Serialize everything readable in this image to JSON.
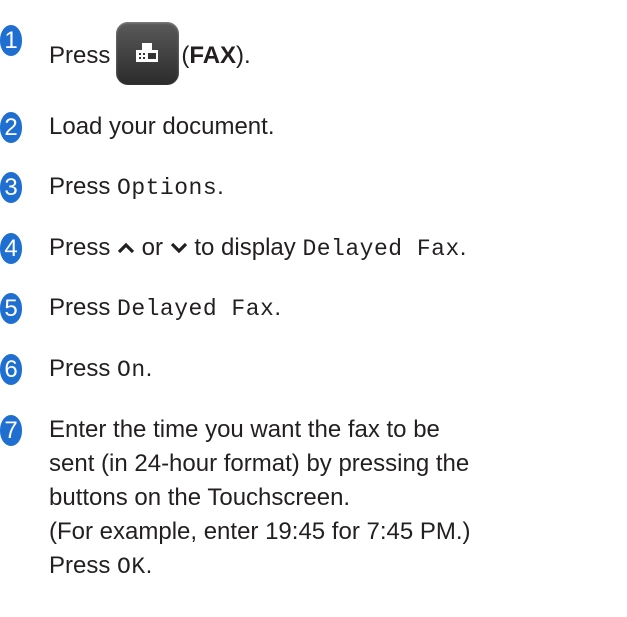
{
  "steps": [
    {
      "num": "1",
      "press": "Press",
      "open": "(",
      "label": "FAX",
      "close": ")."
    },
    {
      "num": "2",
      "text": "Load your document."
    },
    {
      "num": "3",
      "press": "Press ",
      "code": "Options",
      "end": "."
    },
    {
      "num": "4",
      "press": "Press ",
      "or": " or ",
      "mid": " to display ",
      "code": "Delayed Fax",
      "end": "."
    },
    {
      "num": "5",
      "press": "Press ",
      "code": "Delayed Fax",
      "end": "."
    },
    {
      "num": "6",
      "press": "Press ",
      "code": "On",
      "end": "."
    },
    {
      "num": "7",
      "line1": "Enter the time you want the fax to be",
      "line2": "sent (in 24-hour format) by pressing the",
      "line3": "buttons on the Touchscreen.",
      "line4": "(For example, enter 19:45 for 7:45 PM.)",
      "press": "Press ",
      "code": "OK",
      "end": "."
    }
  ],
  "icons": {
    "fax": "fax-icon",
    "up": "chevron-up-icon",
    "down": "chevron-down-icon"
  },
  "colors": {
    "badge": "#1f6fd1",
    "text": "#231f20"
  }
}
